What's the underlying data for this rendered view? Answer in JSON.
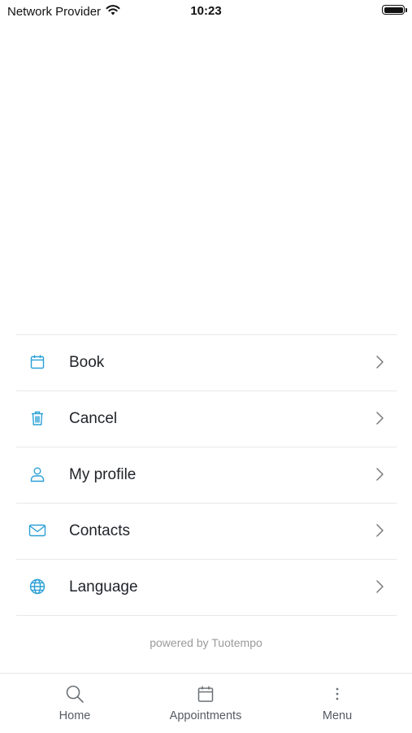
{
  "status_bar": {
    "carrier": "Network Provider",
    "time": "10:23",
    "battery_level": 1.0
  },
  "colors": {
    "accent": "#2a9fd6",
    "text": "#1f2328",
    "divider": "#e8e8e8",
    "muted": "#9a9a9a"
  },
  "menu": {
    "items": [
      {
        "label": "Book",
        "icon": "calendar-icon"
      },
      {
        "label": "Cancel",
        "icon": "trash-icon"
      },
      {
        "label": "My profile",
        "icon": "user-icon"
      },
      {
        "label": "Contacts",
        "icon": "envelope-icon"
      },
      {
        "label": "Language",
        "icon": "globe-icon"
      }
    ]
  },
  "footer": {
    "powered_by": "powered by Tuotempo"
  },
  "tab_bar": {
    "tabs": [
      {
        "label": "Home",
        "icon": "search-icon"
      },
      {
        "label": "Appointments",
        "icon": "calendar-icon"
      },
      {
        "label": "Menu",
        "icon": "more-vertical-icon"
      }
    ]
  }
}
